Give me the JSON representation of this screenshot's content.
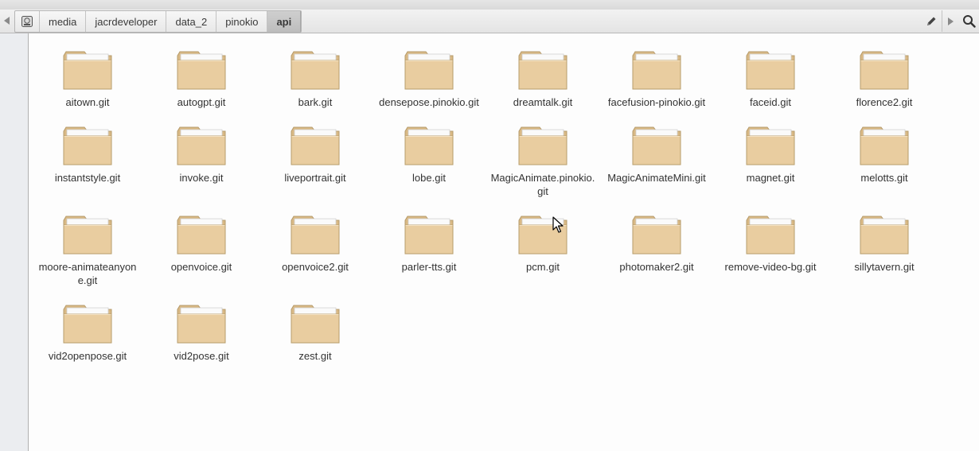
{
  "pathbar": {
    "crumbs": [
      "media",
      "jacrdeveloper",
      "data_2",
      "pinokio",
      "api"
    ],
    "active_index": 4
  },
  "folders": [
    "aitown.git",
    "autogpt.git",
    "bark.git",
    "densepose.pinokio.git",
    "dreamtalk.git",
    "facefusion-pinokio.git",
    "faceid.git",
    "florence2.git",
    "instantstyle.git",
    "invoke.git",
    "liveportrait.git",
    "lobe.git",
    "MagicAnimate.pinokio.git",
    "MagicAnimateMini.git",
    "magnet.git",
    "melotts.git",
    "moore-animateanyone.git",
    "openvoice.git",
    "openvoice2.git",
    "parler-tts.git",
    "pcm.git",
    "photomaker2.git",
    "remove-video-bg.git",
    "sillytavern.git",
    "vid2openpose.git",
    "vid2pose.git",
    "zest.git"
  ],
  "icons": {
    "back": "triangle-left-icon",
    "drive": "drive-icon",
    "edit": "pencil-icon",
    "forward": "triangle-right-icon",
    "search": "search-icon",
    "folder": "folder-icon"
  },
  "colors": {
    "folder_front": "#e9cda0",
    "folder_back": "#d9b985",
    "folder_tab": "#fafafa"
  }
}
